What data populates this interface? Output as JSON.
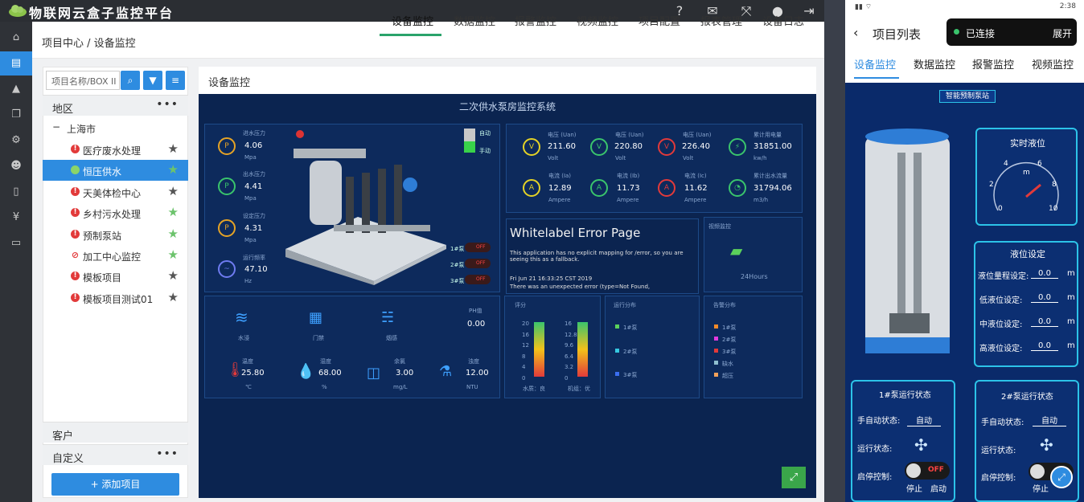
{
  "app": {
    "title": "物联网云盒子监控平台"
  },
  "breadcrumb": "项目中心 / 设备监控",
  "tabs": [
    "设备监控",
    "数据监控",
    "报警监控",
    "视频监控",
    "项目配置",
    "报表管理",
    "设备日志"
  ],
  "left": {
    "search_placeholder": "项目名称/BOX II",
    "region": "地区",
    "city": "上海市",
    "items": [
      "医疗废水处理",
      "恒压供水",
      "天美体检中心",
      "乡村污水处理",
      "预制泵站",
      "加工中心监控",
      "模板项目",
      "模板项目测试01"
    ],
    "customer": "客户",
    "custom": "自定义",
    "add": "+ 添加项目"
  },
  "dash": {
    "panel_title": "设备监控",
    "title": "二次供水泵房监控系统",
    "pressure": [
      {
        "name": "进水压力",
        "v": "4.06",
        "u": "Mpa"
      },
      {
        "name": "出水压力",
        "v": "4.41",
        "u": "Mpa"
      },
      {
        "name": "设定压力",
        "v": "4.31",
        "u": "Mpa"
      },
      {
        "name": "运行频率",
        "v": "47.10",
        "u": "Hz"
      }
    ],
    "auto": "自动",
    "manual": "手动",
    "pumps": [
      "1#泵",
      "2#泵",
      "3#泵"
    ],
    "off": "OFF",
    "volt": [
      {
        "n": "电压 (Uan)",
        "v": "211.60",
        "u": "Volt"
      },
      {
        "n": "电压 (Uan)",
        "v": "220.80",
        "u": "Volt"
      },
      {
        "n": "电压 (Uan)",
        "v": "226.40",
        "u": "Volt"
      },
      {
        "n": "累计用电量",
        "v": "31851.00",
        "u": "kw/h"
      }
    ],
    "amp": [
      {
        "n": "电流 (Ia)",
        "v": "12.89",
        "u": "Ampere"
      },
      {
        "n": "电流 (Ib)",
        "v": "11.73",
        "u": "Ampere"
      },
      {
        "n": "电流 (Ic)",
        "v": "11.62",
        "u": "Ampere"
      },
      {
        "n": "累计出水流量",
        "v": "31794.06",
        "u": "m3/h"
      }
    ],
    "err_title": "Whitelabel Error Page",
    "err1": "This application has no explicit mapping for /error, so you are seeing this as a fallback.",
    "err2": "Fri Jun 21 16:33:25 CST 2019",
    "err3": "There was an unexpected error (type=Not Found,",
    "video": "视频监控",
    "hours": "24Hours",
    "env1": [
      {
        "n": "水浸",
        "v": ""
      },
      {
        "n": "门禁",
        "v": ""
      },
      {
        "n": "烟感",
        "v": ""
      },
      {
        "n": "PH值",
        "v": "0.00"
      }
    ],
    "env2": [
      {
        "n": "温度",
        "v": "25.80",
        "u": "℃"
      },
      {
        "n": "湿度",
        "v": "68.00",
        "u": "%"
      },
      {
        "n": "余氯",
        "v": "3.00",
        "u": "mg/L"
      },
      {
        "n": "浊度",
        "v": "12.00",
        "u": "NTU"
      }
    ],
    "score": "评分",
    "score_y1": [
      "20",
      "16",
      "12",
      "8",
      "4",
      "0"
    ],
    "score_y2": [
      "16",
      "12.8",
      "9.6",
      "6.4",
      "3.2",
      "0"
    ],
    "water": "水质：良",
    "unit": "机组：优",
    "run": "运行分布",
    "alarm": "告警分布",
    "alarm_items": [
      "1#泵",
      "2#泵",
      "3#泵",
      "缺水",
      "超压"
    ]
  },
  "phone": {
    "status": "2:38",
    "title": "项目列表",
    "conn": "已连接",
    "expand": "展开",
    "tabs": [
      "设备监控",
      "数据监控",
      "报警监控",
      "视频监控"
    ],
    "station": "智能预制泵站",
    "level": "实时液位",
    "gauge": [
      "0",
      "2",
      "4",
      "6",
      "8",
      "10"
    ],
    "gunit": "m",
    "set": "液位设定",
    "sets": [
      {
        "l": "液位量程设定:",
        "v": "0.0"
      },
      {
        "l": "低液位设定:",
        "v": "0.0"
      },
      {
        "l": "中液位设定:",
        "v": "0.0"
      },
      {
        "l": "高液位设定:",
        "v": "0.0"
      }
    ],
    "m": "m",
    "p1": "1#泵运行状态",
    "p2": "2#泵运行状态",
    "mode": "手自动状态:",
    "auto": "自动",
    "run": "运行状态:",
    "ctrl": "启停控制:",
    "off": "OFF",
    "stop": "停止",
    "start": "启动"
  }
}
